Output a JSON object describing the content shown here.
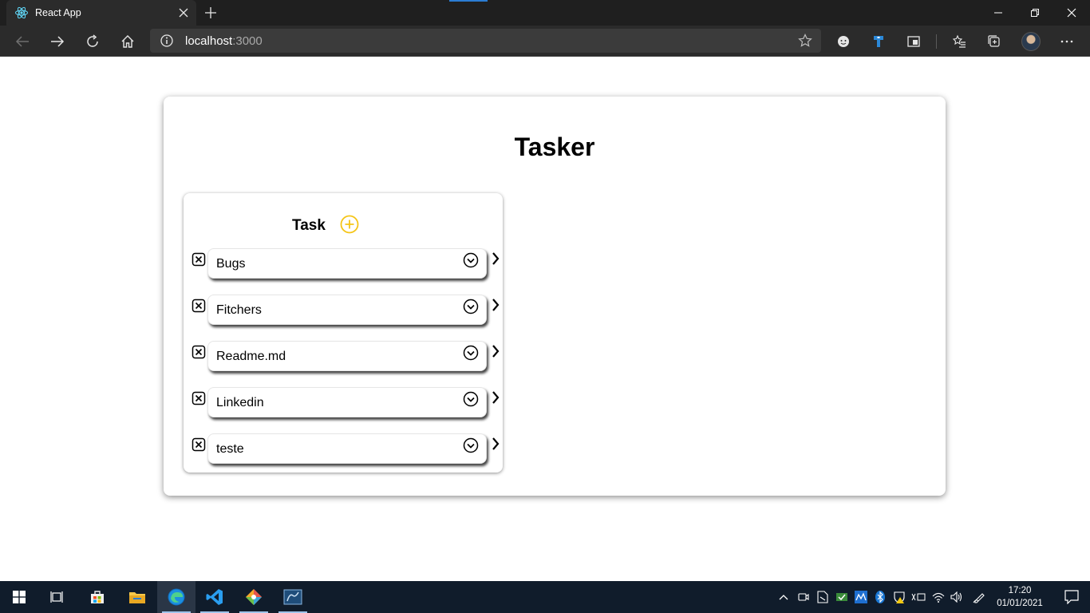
{
  "browser": {
    "tab_title": "React App",
    "address_host": "localhost",
    "address_port": ":3000"
  },
  "app": {
    "title": "Tasker",
    "column": {
      "title": "Task",
      "accent_color": "#f5c518",
      "tasks": [
        {
          "label": "Bugs"
        },
        {
          "label": "Fitchers"
        },
        {
          "label": "Readme.md"
        },
        {
          "label": "Linkedin"
        },
        {
          "label": "teste"
        }
      ]
    }
  },
  "taskbar": {
    "time": "17:20",
    "date": "01/01/2021",
    "pinned_apps": [
      "start-icon",
      "task-view-icon",
      "store-icon",
      "file-explorer-icon",
      "edge-icon",
      "vscode-icon",
      "git-icon",
      "database-icon"
    ]
  }
}
